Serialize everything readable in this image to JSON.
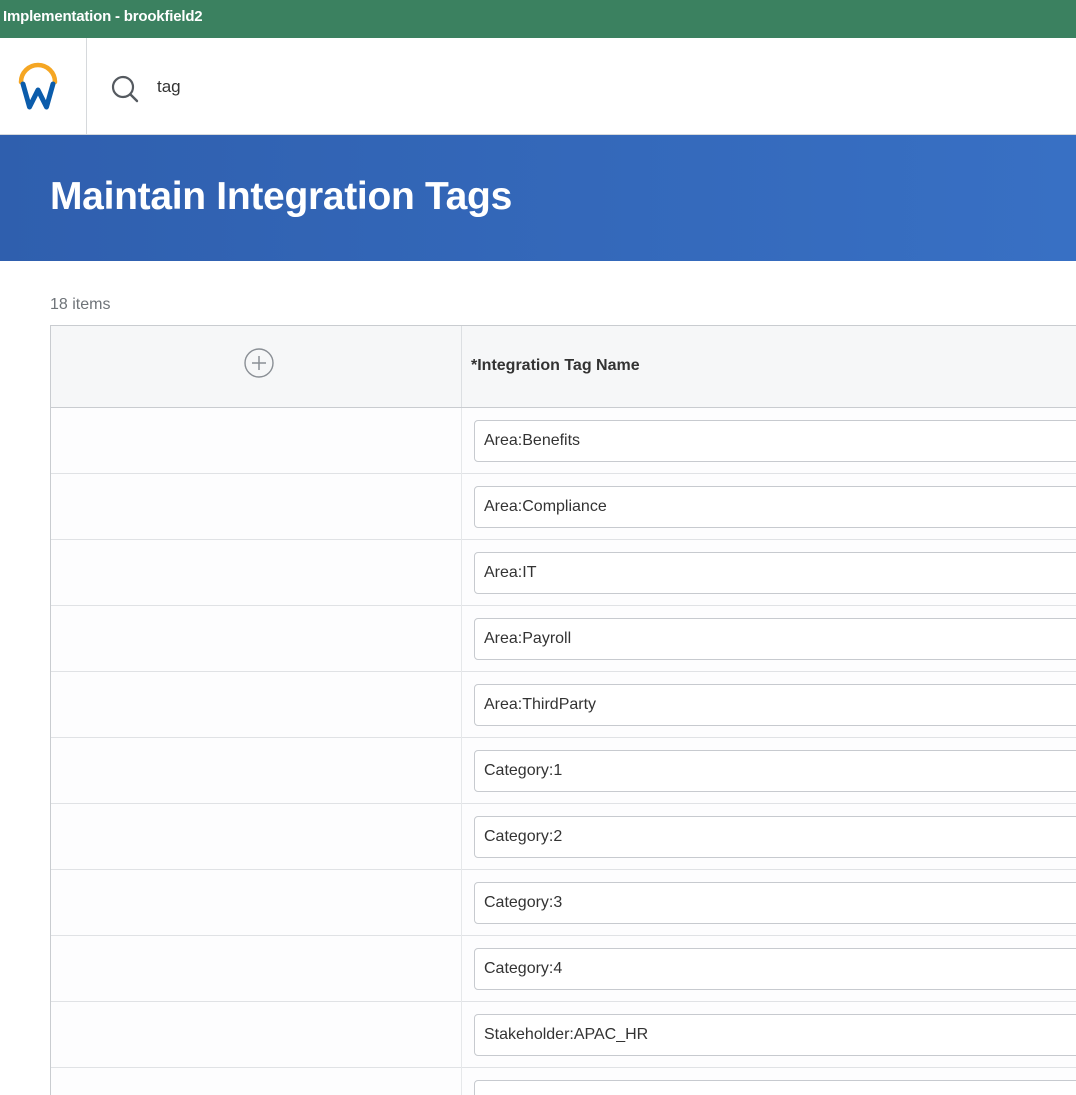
{
  "env": {
    "title": "Implementation - brookfield2"
  },
  "search": {
    "value": "tag"
  },
  "page": {
    "title": "Maintain Integration Tags",
    "items_count": "18 items"
  },
  "grid": {
    "column_header": "*Integration Tag Name",
    "rows": [
      "Area:Benefits",
      "Area:Compliance",
      "Area:IT",
      "Area:Payroll",
      "Area:ThirdParty",
      "Category:1",
      "Category:2",
      "Category:3",
      "Category:4",
      "Stakeholder:APAC_HR",
      ""
    ]
  },
  "colors": {
    "env_bar": "#3b8160",
    "banner": "#3870c4",
    "logo_arc": "#f5a623",
    "logo_w": "#0b5cab"
  },
  "icons": [
    "workday-logo-icon",
    "search-icon",
    "add-row-icon"
  ]
}
